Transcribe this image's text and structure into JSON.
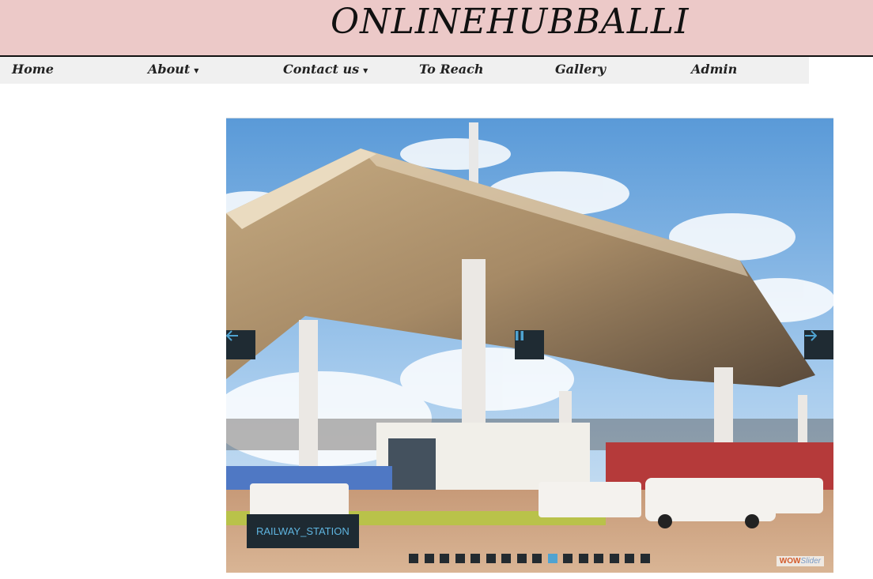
{
  "header": {
    "title": "ONLINEHUBBALLI"
  },
  "nav": {
    "items": [
      {
        "label": "Home",
        "dropdown": false
      },
      {
        "label": "About",
        "dropdown": true
      },
      {
        "label": "Contact us",
        "dropdown": true
      },
      {
        "label": "To Reach",
        "dropdown": false
      },
      {
        "label": "Gallery",
        "dropdown": false
      },
      {
        "label": "Admin",
        "dropdown": false
      }
    ]
  },
  "slider": {
    "caption": "RAILWAY_STATION",
    "bullet_count": 16,
    "active_bullet": 10,
    "watermark_a": "WOW",
    "watermark_b": "Slider",
    "icons": {
      "prev": "arrow-left-icon",
      "next": "arrow-right-icon",
      "pause": "pause-icon"
    },
    "colors": {
      "button_bg": "#1f2b33",
      "arrow": "#4fa3d1",
      "caption_text": "#5fb5e0"
    }
  }
}
